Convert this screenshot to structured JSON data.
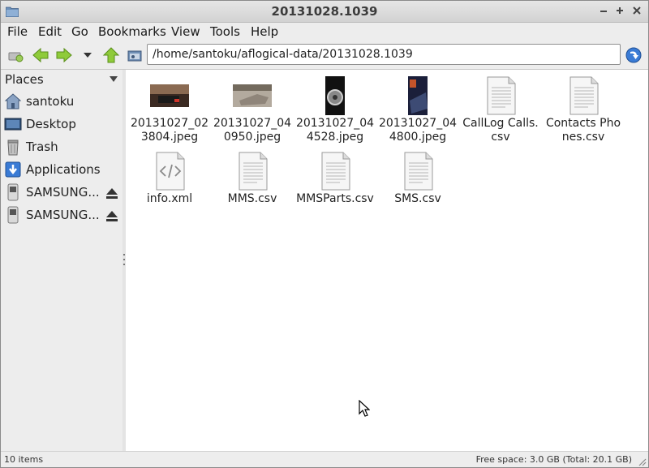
{
  "window": {
    "title": "20131028.1039"
  },
  "menubar": {
    "items": [
      "File",
      "Edit",
      "Go",
      "Bookmarks",
      "View",
      "Tools",
      "Help"
    ]
  },
  "toolbar": {
    "path": "/home/santoku/aflogical-data/20131028.1039"
  },
  "sidebar": {
    "header": "Places",
    "items": [
      {
        "label": "santoku",
        "icon": "home-icon"
      },
      {
        "label": "Desktop",
        "icon": "desktop-icon"
      },
      {
        "label": "Trash",
        "icon": "trash-icon"
      },
      {
        "label": "Applications",
        "icon": "applications-icon"
      },
      {
        "label": "SAMSUNG...",
        "icon": "drive-icon"
      },
      {
        "label": "SAMSUNG...",
        "icon": "drive-icon"
      }
    ]
  },
  "files": [
    {
      "name": "20131027_023804.jpeg",
      "icon": "image-thumbnail"
    },
    {
      "name": "20131027_040950.jpeg",
      "icon": "image-thumbnail"
    },
    {
      "name": "20131027_044528.jpeg",
      "icon": "image-thumbnail"
    },
    {
      "name": "20131027_044800.jpeg",
      "icon": "image-thumbnail"
    },
    {
      "name": "CallLog Calls.csv",
      "icon": "text-document-icon"
    },
    {
      "name": "Contacts Phones.csv",
      "icon": "text-document-icon"
    },
    {
      "name": "info.xml",
      "icon": "xml-document-icon"
    },
    {
      "name": "MMS.csv",
      "icon": "text-document-icon"
    },
    {
      "name": "MMSParts.csv",
      "icon": "text-document-icon"
    },
    {
      "name": "SMS.csv",
      "icon": "text-document-icon"
    }
  ],
  "statusbar": {
    "item_count": "10 items",
    "free_space": "Free space: 3.0 GB (Total: 20.1 GB)"
  },
  "colors": {
    "accent": "#3a7bd5",
    "toolbar_arrow": "#7fbf2f"
  }
}
